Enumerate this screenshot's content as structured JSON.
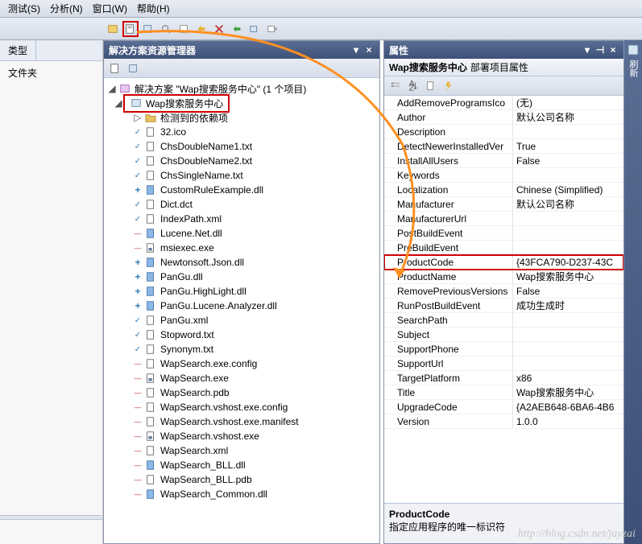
{
  "menu": {
    "items": [
      "测试(S)",
      "分析(N)",
      "窗口(W)",
      "帮助(H)"
    ]
  },
  "panels": {
    "explorer_title": "解决方案资源管理器",
    "props_title": "属性"
  },
  "left": {
    "tab1": "类型",
    "item1": "文件夹"
  },
  "tree": {
    "root": "解决方案 \"Wap搜索服务中心\" (1 个项目)",
    "project": "Wap搜索服务中心",
    "deps": "检测到的依赖项",
    "files": [
      {
        "n": "32.ico",
        "m": "check",
        "t": "file"
      },
      {
        "n": "ChsDoubleName1.txt",
        "m": "check",
        "t": "file"
      },
      {
        "n": "ChsDoubleName2.txt",
        "m": "check",
        "t": "file"
      },
      {
        "n": "ChsSingleName.txt",
        "m": "check",
        "t": "file"
      },
      {
        "n": "CustomRuleExample.dll",
        "m": "plus",
        "t": "dll"
      },
      {
        "n": "Dict.dct",
        "m": "check",
        "t": "file"
      },
      {
        "n": "IndexPath.xml",
        "m": "check",
        "t": "file"
      },
      {
        "n": "Lucene.Net.dll",
        "m": "minus",
        "t": "dll"
      },
      {
        "n": "msiexec.exe",
        "m": "minus",
        "t": "exe"
      },
      {
        "n": "Newtonsoft.Json.dll",
        "m": "plus",
        "t": "dll"
      },
      {
        "n": "PanGu.dll",
        "m": "plus",
        "t": "dll"
      },
      {
        "n": "PanGu.HighLight.dll",
        "m": "plus",
        "t": "dll"
      },
      {
        "n": "PanGu.Lucene.Analyzer.dll",
        "m": "plus",
        "t": "dll"
      },
      {
        "n": "PanGu.xml",
        "m": "check",
        "t": "file"
      },
      {
        "n": "Stopword.txt",
        "m": "check",
        "t": "file"
      },
      {
        "n": "Synonym.txt",
        "m": "check",
        "t": "file"
      },
      {
        "n": "WapSearch.exe.config",
        "m": "minus",
        "t": "file"
      },
      {
        "n": "WapSearch.exe",
        "m": "minus",
        "t": "exe"
      },
      {
        "n": "WapSearch.pdb",
        "m": "minus",
        "t": "file"
      },
      {
        "n": "WapSearch.vshost.exe.config",
        "m": "minus",
        "t": "file"
      },
      {
        "n": "WapSearch.vshost.exe.manifest",
        "m": "minus",
        "t": "file"
      },
      {
        "n": "WapSearch.vshost.exe",
        "m": "minus",
        "t": "exe"
      },
      {
        "n": "WapSearch.xml",
        "m": "minus",
        "t": "file"
      },
      {
        "n": "WapSearch_BLL.dll",
        "m": "minus",
        "t": "dll"
      },
      {
        "n": "WapSearch_BLL.pdb",
        "m": "minus",
        "t": "file"
      },
      {
        "n": "WapSearch_Common.dll",
        "m": "minus",
        "t": "dll"
      }
    ]
  },
  "props": {
    "obj_name": "Wap搜索服务中心",
    "obj_kind": "部署项目属性",
    "rows": [
      {
        "n": "AddRemoveProgramsIco",
        "v": "(无)"
      },
      {
        "n": "Author",
        "v": "默认公司名称"
      },
      {
        "n": "Description",
        "v": ""
      },
      {
        "n": "DetectNewerInstalledVer",
        "v": "True"
      },
      {
        "n": "InstallAllUsers",
        "v": "False"
      },
      {
        "n": "Keywords",
        "v": ""
      },
      {
        "n": "Localization",
        "v": "Chinese (Simplified)"
      },
      {
        "n": "Manufacturer",
        "v": "默认公司名称"
      },
      {
        "n": "ManufacturerUrl",
        "v": ""
      },
      {
        "n": "PostBuildEvent",
        "v": ""
      },
      {
        "n": "PreBuildEvent",
        "v": ""
      },
      {
        "n": "ProductCode",
        "v": "{43FCA790-D237-43C",
        "hl": true
      },
      {
        "n": "ProductName",
        "v": "Wap搜索服务中心"
      },
      {
        "n": "RemovePreviousVersions",
        "v": "False"
      },
      {
        "n": "RunPostBuildEvent",
        "v": "成功生成时"
      },
      {
        "n": "SearchPath",
        "v": ""
      },
      {
        "n": "Subject",
        "v": ""
      },
      {
        "n": "SupportPhone",
        "v": ""
      },
      {
        "n": "SupportUrl",
        "v": ""
      },
      {
        "n": "TargetPlatform",
        "v": "x86"
      },
      {
        "n": "Title",
        "v": "Wap搜索服务中心"
      },
      {
        "n": "UpgradeCode",
        "v": "{A2AEB648-6BA6-4B6"
      },
      {
        "n": "Version",
        "v": "1.0.0"
      }
    ],
    "desc_name": "ProductCode",
    "desc_text": "指定应用程序的唯一标识符"
  },
  "rightedge": {
    "label": "刷新"
  },
  "watermark": "http://blog.csdn.net/jayzai"
}
